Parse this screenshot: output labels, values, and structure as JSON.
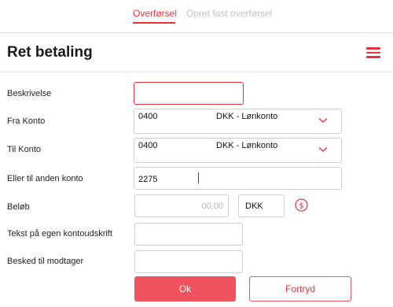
{
  "tabs": {
    "active_label": "Overførsel",
    "inactive_label": "Opret fast overførsel"
  },
  "header": {
    "title": "Ret betaling",
    "menu_icon": "hamburger-menu-icon"
  },
  "form": {
    "description": {
      "label": "Beskrivelse",
      "value": ""
    },
    "from_account": {
      "label": "Fra Konto",
      "reg": "0400",
      "name": "DKK - Lønkonto"
    },
    "to_account": {
      "label": "Til Konto",
      "reg": "0400",
      "name": "DKK - Lønkonto"
    },
    "other_account": {
      "label": "Eller til anden konto",
      "value": "2275"
    },
    "amount": {
      "label": "Beløb",
      "placeholder": "00,00",
      "currency": "DKK",
      "currency_icon": "dollar-circle-icon"
    },
    "own_statement_text": {
      "label": "Tekst på egen kontoudskrift",
      "value": ""
    },
    "recipient_message": {
      "label": "Besked til modtager",
      "value": ""
    }
  },
  "buttons": {
    "ok": "Ok",
    "cancel": "Fortryd"
  },
  "colors": {
    "accent": "#e8313e",
    "button_fill": "#f0535d",
    "border": "#cfcfcf"
  }
}
